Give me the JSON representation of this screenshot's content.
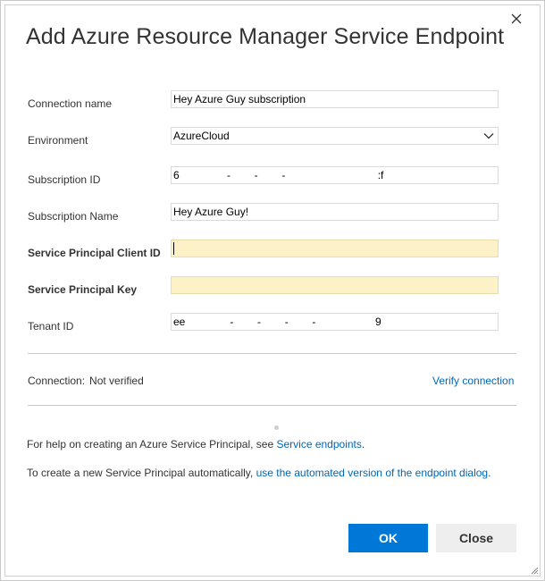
{
  "dialog": {
    "title": "Add Azure Resource Manager Service Endpoint",
    "close_icon": "close-icon"
  },
  "form": {
    "connection_name": {
      "label": "Connection name",
      "value": "Hey Azure Guy subscription"
    },
    "environment": {
      "label": "Environment",
      "value": "AzureCloud",
      "icon": "chevron-down-icon"
    },
    "subscription_id": {
      "label": "Subscription ID",
      "value": "6                -        -        -                               :f"
    },
    "subscription_name": {
      "label": "Subscription Name",
      "value": "Hey Azure Guy!"
    },
    "sp_client_id": {
      "label": "Service Principal Client ID",
      "value": ""
    },
    "sp_key": {
      "label": "Service Principal Key",
      "value": ""
    },
    "tenant_id": {
      "label": "Tenant ID",
      "value": "ee               -        -        -        -                    9"
    }
  },
  "connection": {
    "label": "Connection:",
    "status": "Not verified",
    "verify_link": "Verify connection"
  },
  "help": {
    "line1_prefix": "For help on creating an Azure Service Principal, see ",
    "line1_link": "Service endpoints",
    "line1_suffix": ".",
    "line2_prefix": "To create a new Service Principal automatically, ",
    "line2_link": "use the automated version of the endpoint dialog."
  },
  "buttons": {
    "ok": "OK",
    "close": "Close"
  },
  "colors": {
    "primary": "#0078d7",
    "link": "#0066b8",
    "required_field": "#fdf1c8"
  }
}
